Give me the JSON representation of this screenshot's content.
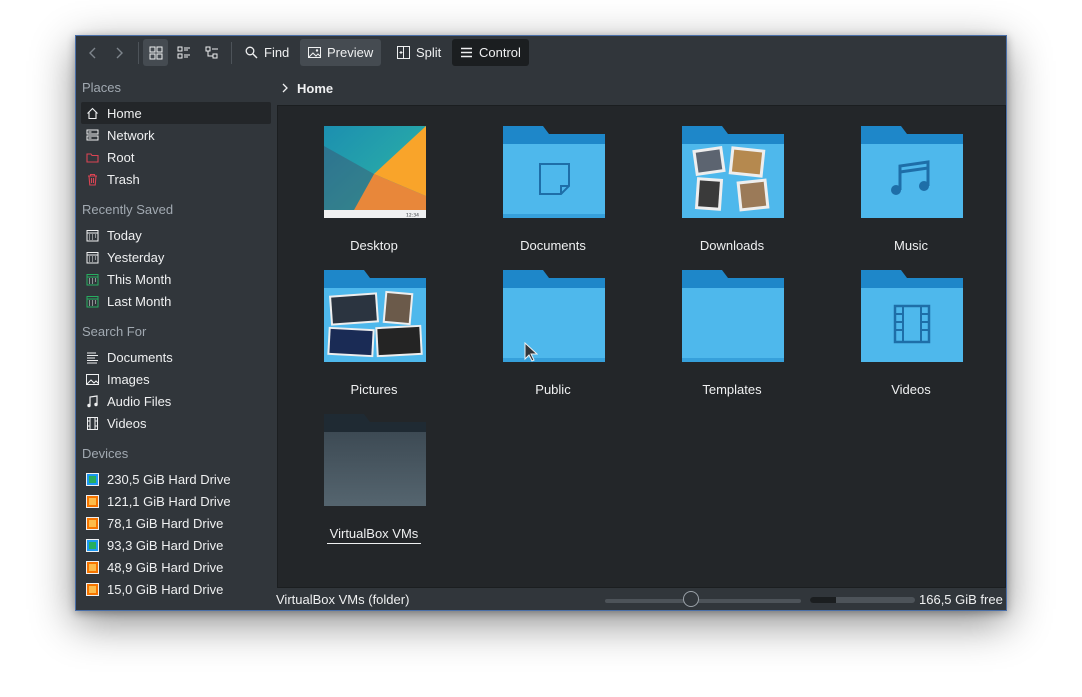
{
  "toolbar": {
    "find_label": "Find",
    "preview_label": "Preview",
    "split_label": "Split",
    "control_label": "Control"
  },
  "sidebar": {
    "places_title": "Places",
    "places": [
      {
        "label": "Home",
        "icon": "home-icon"
      },
      {
        "label": "Network",
        "icon": "network-icon"
      },
      {
        "label": "Root",
        "icon": "root-folder-icon"
      },
      {
        "label": "Trash",
        "icon": "trash-icon"
      }
    ],
    "recent_title": "Recently Saved",
    "recent": [
      {
        "label": "Today",
        "icon": "calendar-icon"
      },
      {
        "label": "Yesterday",
        "icon": "calendar-icon"
      },
      {
        "label": "This Month",
        "icon": "calendar-icon"
      },
      {
        "label": "Last Month",
        "icon": "calendar-icon"
      }
    ],
    "search_title": "Search For",
    "search": [
      {
        "label": "Documents",
        "icon": "document-icon"
      },
      {
        "label": "Images",
        "icon": "image-icon"
      },
      {
        "label": "Audio Files",
        "icon": "audio-icon"
      },
      {
        "label": "Videos",
        "icon": "video-icon"
      }
    ],
    "devices_title": "Devices",
    "devices": [
      {
        "label": "230,5 GiB Hard Drive",
        "icon": "hard-drive-icon"
      },
      {
        "label": "121,1 GiB Hard Drive",
        "icon": "hard-drive-icon"
      },
      {
        "label": "78,1 GiB Hard Drive",
        "icon": "hard-drive-icon"
      },
      {
        "label": "93,3 GiB Hard Drive",
        "icon": "hard-drive-icon"
      },
      {
        "label": "48,9 GiB Hard Drive",
        "icon": "hard-drive-icon"
      },
      {
        "label": "15,0 GiB Hard Drive",
        "icon": "hard-drive-icon"
      }
    ]
  },
  "breadcrumb": {
    "current": "Home"
  },
  "files": [
    {
      "name": "Desktop",
      "kind": "desktop-preview"
    },
    {
      "name": "Documents",
      "kind": "folder-documents"
    },
    {
      "name": "Downloads",
      "kind": "folder-photos"
    },
    {
      "name": "Music",
      "kind": "folder-music"
    },
    {
      "name": "Pictures",
      "kind": "folder-photos"
    },
    {
      "name": "Public",
      "kind": "folder"
    },
    {
      "name": "Templates",
      "kind": "folder"
    },
    {
      "name": "Videos",
      "kind": "folder-videos"
    },
    {
      "name": "VirtualBox VMs",
      "kind": "folder-dark"
    }
  ],
  "status": {
    "selection_text": "VirtualBox VMs (folder)",
    "free_space": "166,5 GiB free",
    "zoom_level": 0.44,
    "used_fraction": 0.25
  },
  "colors": {
    "accent": "#3daee9",
    "folder_light": "#4eb8ec",
    "folder_dark": "#1e87c9"
  }
}
